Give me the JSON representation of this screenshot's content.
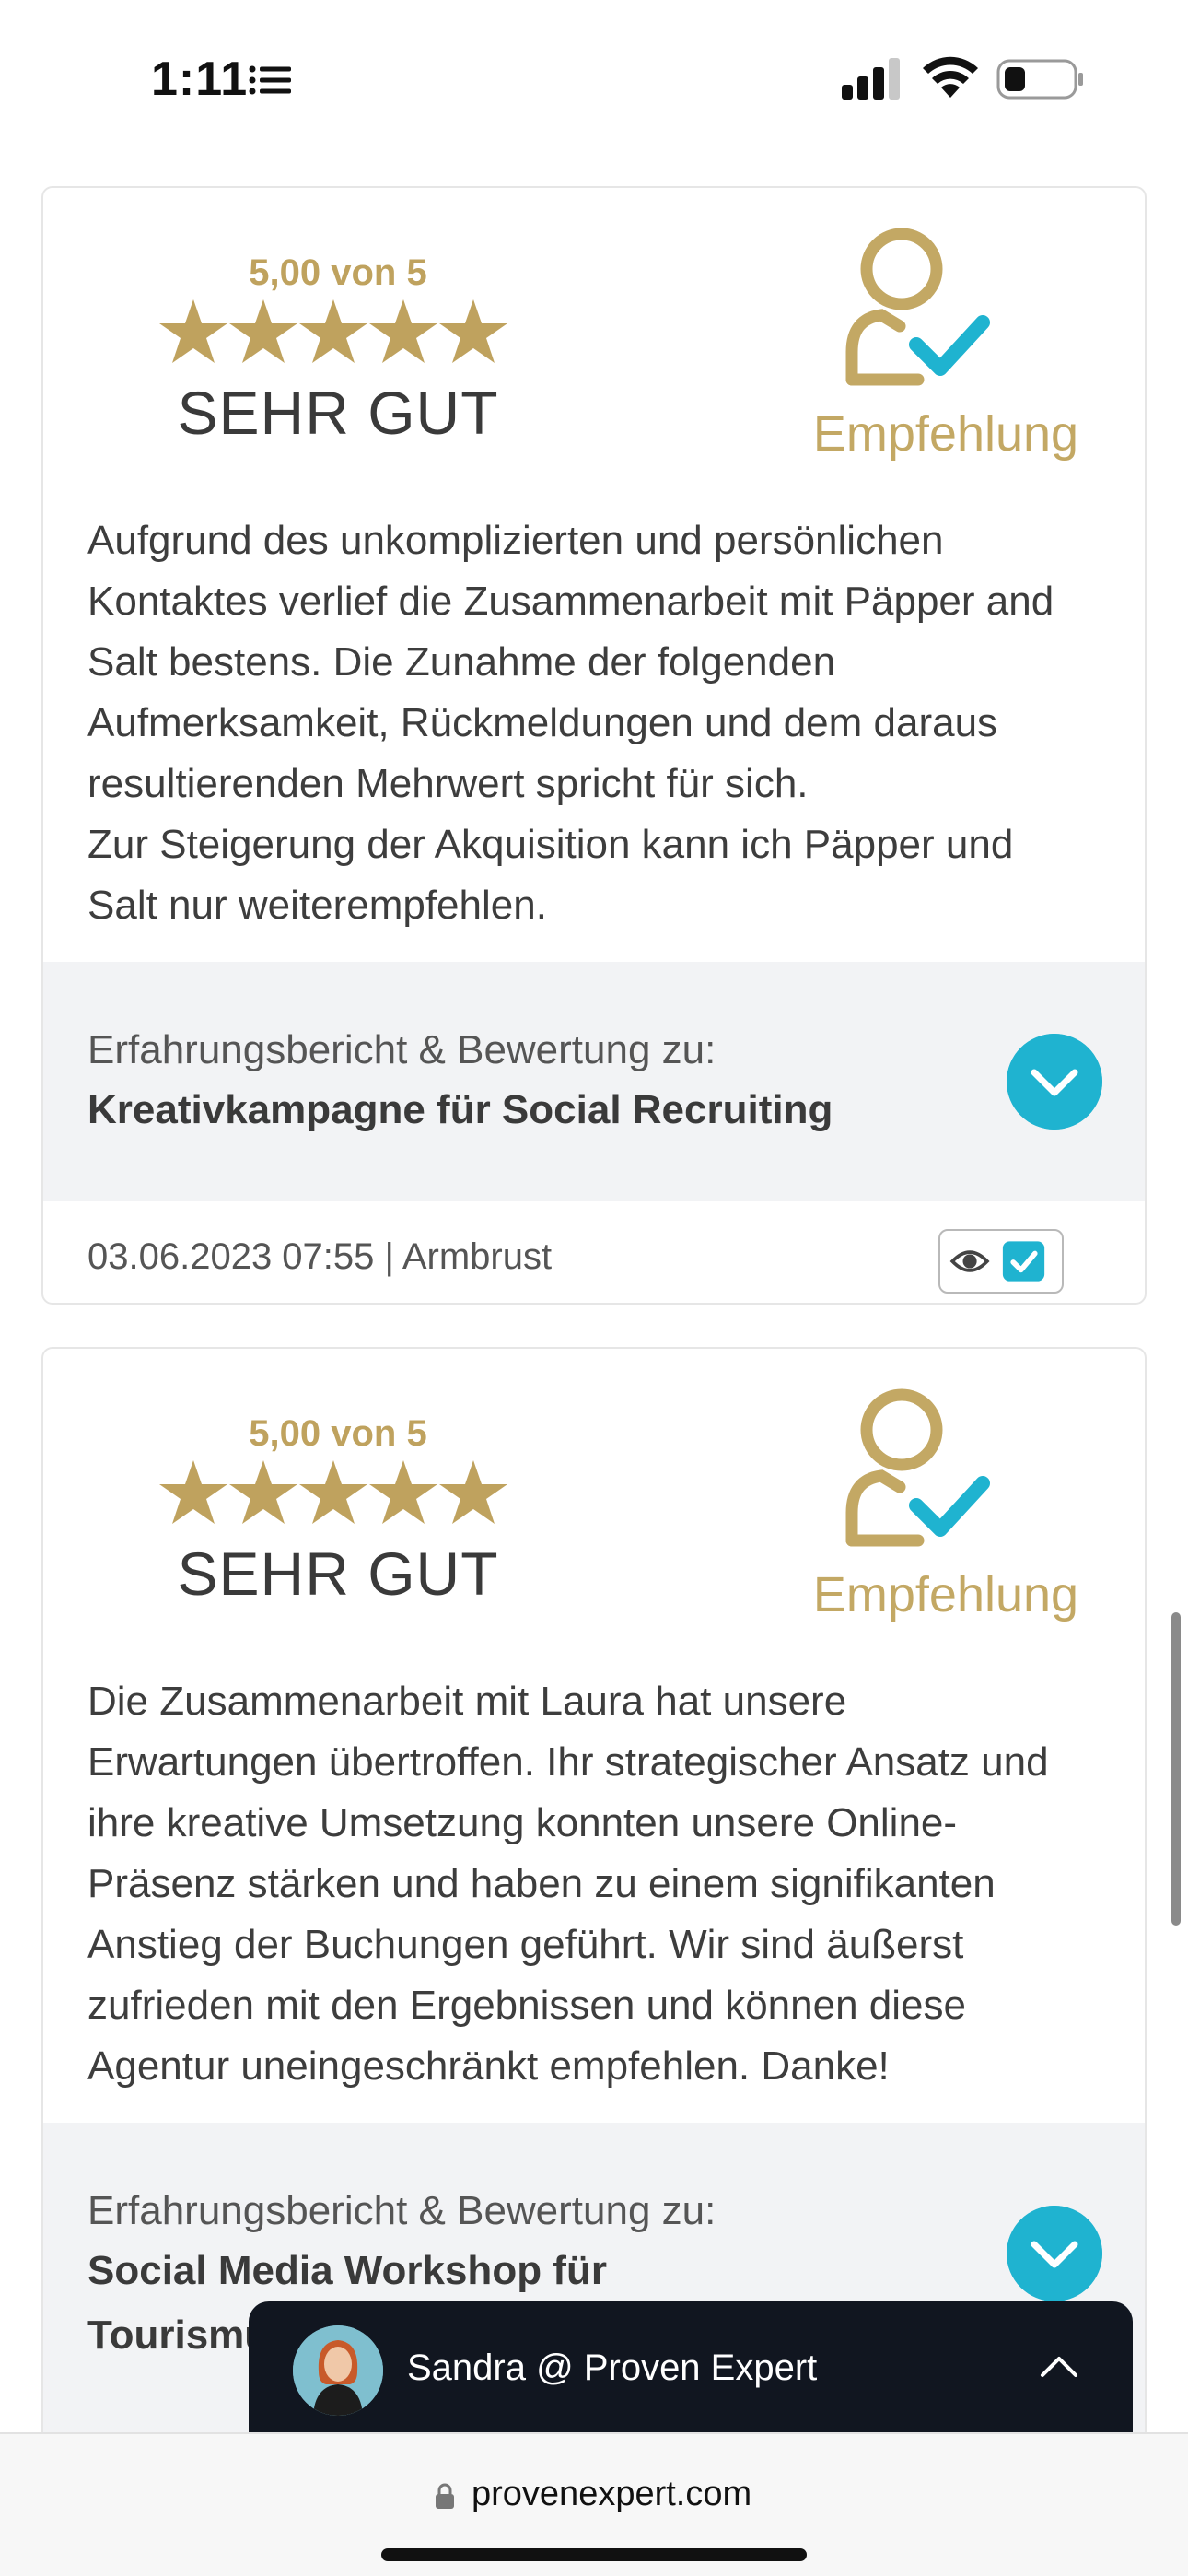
{
  "status_bar": {
    "time": "1:11"
  },
  "reviews": [
    {
      "score": "5,00 von 5",
      "stars": 5,
      "verdict": "SEHR GUT",
      "recommendation_label": "Empfehlung",
      "text_lines": [
        "Aufgrund des unkomplizierten und persönlichen",
        "Kontaktes verlief die Zusammenarbeit mit Päpper and",
        "Salt bestens. Die Zunahme der folgenden",
        "Aufmerksamkeit, Rückmeldungen und dem daraus",
        "resultierenden Mehrwert spricht für sich.",
        "Zur Steigerung der Akquisition kann ich Päpper und",
        "Salt nur weiterempfehlen."
      ],
      "project_caption": "Erfahrungsbericht & Bewertung zu:",
      "project_name": "Kreativkampagne für Social Recruiting",
      "meta": "03.06.2023 07:55 | Armbrust"
    },
    {
      "score": "5,00 von 5",
      "stars": 5,
      "verdict": "SEHR GUT",
      "recommendation_label": "Empfehlung",
      "text_lines": [
        "Die Zusammenarbeit mit Laura hat unsere",
        "Erwartungen übertroffen. Ihr strategischer Ansatz und",
        "ihre kreative Umsetzung konnten unsere Online-",
        "Präsenz stärken und haben zu einem signifikanten",
        "Anstieg der Buchungen geführt. Wir sind äußerst",
        "zufrieden mit den Ergebnissen und können diese",
        "Agentur uneingeschränkt empfehlen. Danke!"
      ],
      "project_caption": "Erfahrungsbericht & Bewertung zu:",
      "project_name": "Social Media Workshop für Tourismu"
    }
  ],
  "chat_widget": {
    "label": "Sandra @ Proven Expert"
  },
  "browser": {
    "url": "provenexpert.com"
  },
  "colors": {
    "gold": "#bfa25e",
    "accent_blue": "#1fb3d0",
    "chat_bg": "#111620"
  }
}
